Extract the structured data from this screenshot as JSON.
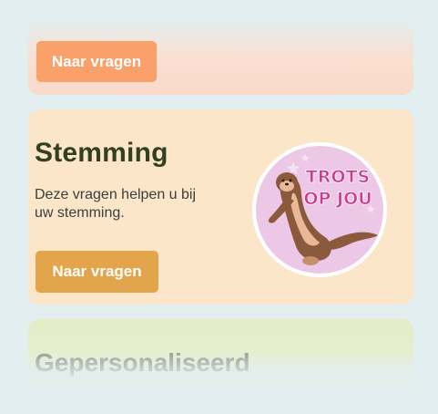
{
  "cards": {
    "top": {
      "button_label": "Naar vragen"
    },
    "mood": {
      "title": "Stemming",
      "description": "Deze vragen helpen u bij uw stemming.",
      "button_label": "Naar vragen",
      "sticker_text_line1": "TROTS",
      "sticker_text_line2": "OP JOU",
      "sticker_icon": "otter-sticker-icon"
    },
    "personalized": {
      "title": "Gepersonaliseerd"
    }
  },
  "colors": {
    "background": "#e2eef0",
    "mood_card": "#fbe6c9",
    "mood_button": "#e2a54c",
    "top_button": "#f9a06b",
    "top_card": "#fadccf",
    "personalized_card": "#e5ecc6",
    "title_text": "#33401f",
    "sticker_pink": "#cf3a8e",
    "sticker_bg": "#ecc7e6"
  }
}
